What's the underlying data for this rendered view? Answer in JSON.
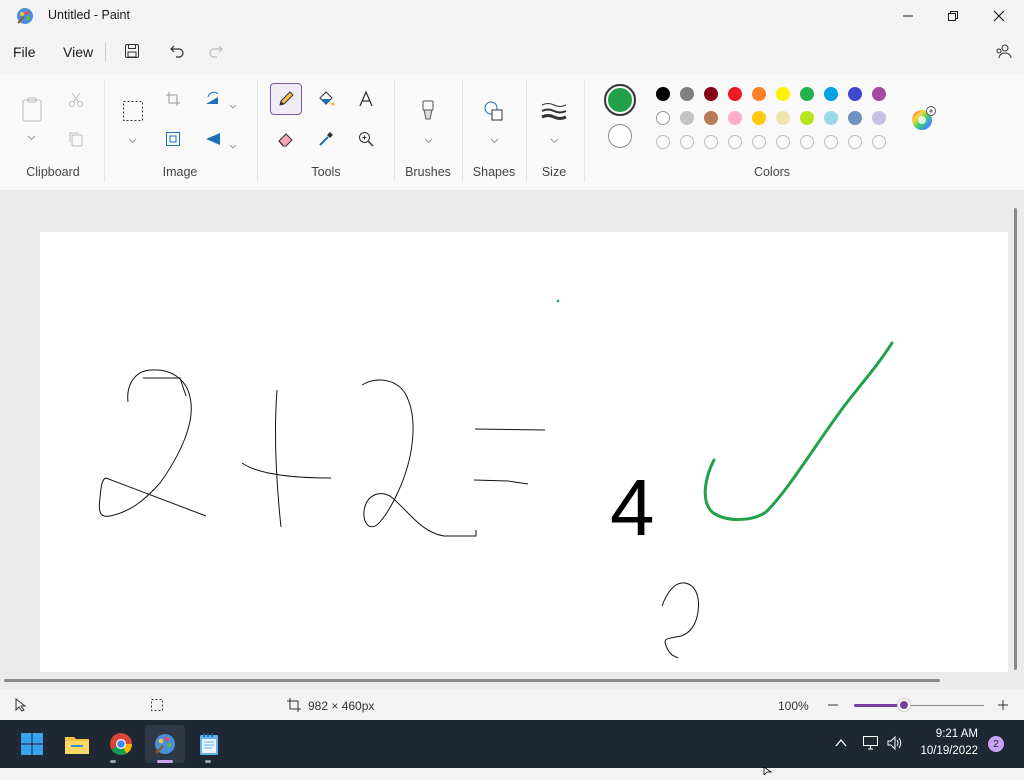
{
  "window": {
    "title": "Untitled - Paint"
  },
  "menu": {
    "file": "File",
    "view": "View"
  },
  "ribbon": {
    "groups": {
      "clipboard": "Clipboard",
      "image": "Image",
      "tools": "Tools",
      "brushes": "Brushes",
      "shapes": "Shapes",
      "size": "Size",
      "colors": "Colors"
    }
  },
  "colors": {
    "primary": "#22a14a",
    "secondary": "#ffffff",
    "palette_row1": [
      "#000000",
      "#7f7f7f",
      "#880015",
      "#ed1c24",
      "#ff7f27",
      "#fff200",
      "#22b14c",
      "#00a2e8",
      "#3f48cc",
      "#a349a4"
    ],
    "palette_row2": [
      "#ffffff",
      "#c3c3c3",
      "#b97a57",
      "#ffaec9",
      "#ffc90e",
      "#efe4b0",
      "#b5e61d",
      "#99d9ea",
      "#7092be",
      "#c8bfe7"
    ],
    "palette_row3_count": 10
  },
  "canvas": {
    "text_four": "4"
  },
  "status": {
    "canvas_size": "982 × 460px",
    "zoom": "100%"
  },
  "taskbar": {
    "time": "9:21 AM",
    "date": "10/19/2022",
    "notification_count": "2"
  }
}
